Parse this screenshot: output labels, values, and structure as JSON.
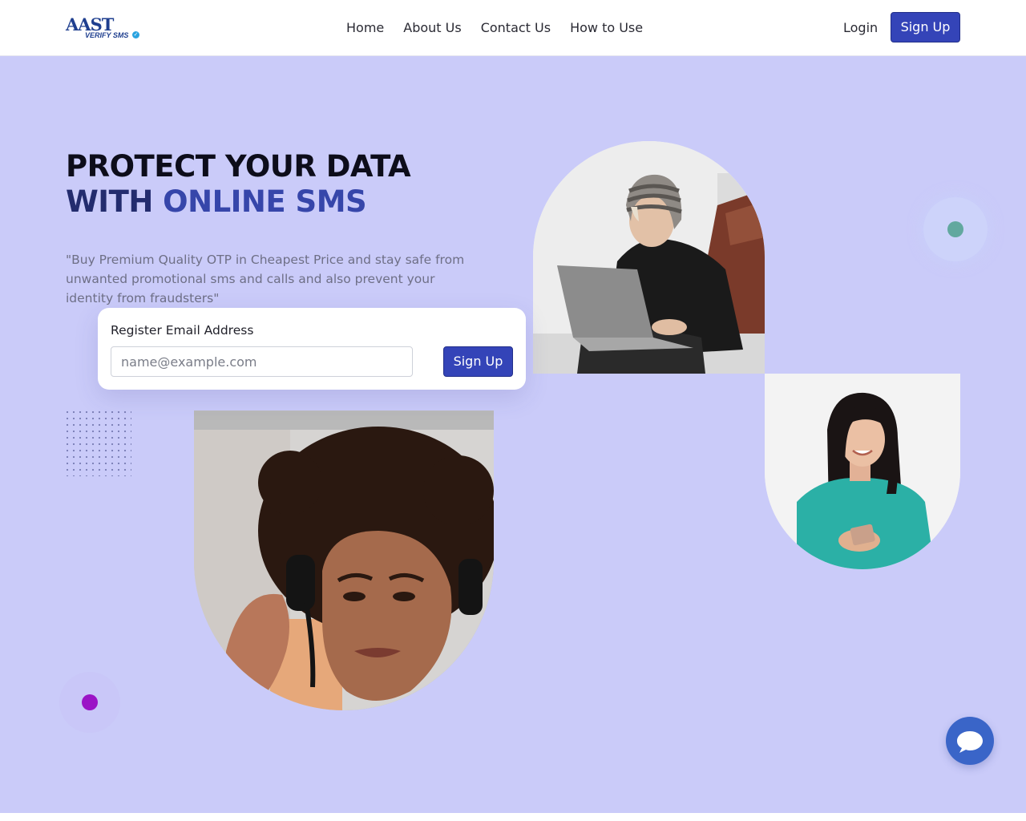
{
  "brand": {
    "logo_main": "AAST",
    "logo_sub": "VERIFY SMS",
    "accent_color": "#3444b8",
    "hero_bg": "#cacbf9"
  },
  "nav": {
    "items": [
      {
        "label": "Home"
      },
      {
        "label": "About Us"
      },
      {
        "label": "Contact Us"
      },
      {
        "label": "How to Use"
      }
    ],
    "login_label": "Login",
    "signup_label": "Sign Up"
  },
  "hero": {
    "headline_line1": "PROTECT YOUR DATA",
    "headline_line2_prefix": "WITH ",
    "headline_line2_accent": "ONLINE SMS",
    "description": "\"Buy Premium Quality OTP in Cheapest Price and stay safe from unwanted promotional sms and calls and also prevent your identity from fraudsters\""
  },
  "register": {
    "label": "Register Email Address",
    "placeholder": "name@example.com",
    "value": "",
    "button_label": "Sign Up"
  },
  "images": {
    "laptop": "person-with-laptop-photo",
    "phone": "woman-with-phone-photo",
    "headset": "woman-with-headset-photo"
  },
  "icons": {
    "chat": "chat-bubble-icon",
    "verified": "check-badge-icon"
  }
}
